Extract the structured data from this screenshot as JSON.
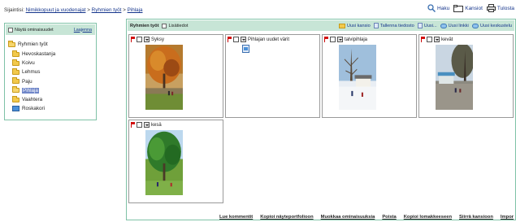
{
  "breadcrumb": {
    "prefix": "Sijaintisi:",
    "items": [
      "Nimikkopuut ja vuodenajat",
      "Ryhmien työt",
      "Pihlaja"
    ],
    "separator": ">"
  },
  "top_actions": [
    {
      "label": "Haku",
      "icon": "search-icon"
    },
    {
      "label": "Kansiot",
      "icon": "folder-icon"
    },
    {
      "label": "Tulosta",
      "icon": "print-icon"
    }
  ],
  "sidebar": {
    "show_props_label": "Näytä ominaisuudet",
    "toggle_label": "Laajenna",
    "root": {
      "label": "Ryhmien työt",
      "icon": "open-folder-icon"
    },
    "items": [
      {
        "label": "Hevoskastanja",
        "selected": false
      },
      {
        "label": "Koivu",
        "selected": false
      },
      {
        "label": "Lehmus",
        "selected": false
      },
      {
        "label": "Paju",
        "selected": false
      },
      {
        "label": "Pihlaja",
        "selected": true
      },
      {
        "label": "Vaahtera",
        "selected": false
      }
    ],
    "trash": {
      "label": "Roskakori",
      "icon": "trash-icon"
    }
  },
  "main": {
    "title": "Ryhmien työt",
    "details_label": "Lisätiedot",
    "toolbar": [
      {
        "label": "Uusi kansio",
        "icon": "folder-icon"
      },
      {
        "label": "Tallenna tiedosto",
        "icon": "document-icon"
      },
      {
        "label": "Uusi...",
        "icon": "new-icon"
      },
      {
        "label": "Uusi linkki",
        "icon": "link-icon"
      },
      {
        "label": "Uusi keskustelu",
        "icon": "discussion-icon"
      }
    ],
    "cards": [
      {
        "title": "Syksy"
      },
      {
        "title": "Pihlajan uudet värit"
      },
      {
        "title": "talvipihlaja"
      },
      {
        "title": "kevät"
      },
      {
        "title": "kesä"
      }
    ],
    "bottom_links": [
      "Lue kommentit",
      "Kopioi näyteportfolioon",
      "Muokkaa ominaisuuksia",
      "Poista",
      "Kopioi lomakkeeseen",
      "Siirrä kansioon",
      "Impor"
    ]
  },
  "colors": {
    "panel_border": "#7fc2a7",
    "panel_header": "#c7e5d6",
    "link": "#15358c",
    "selected": "#6f86c9"
  }
}
